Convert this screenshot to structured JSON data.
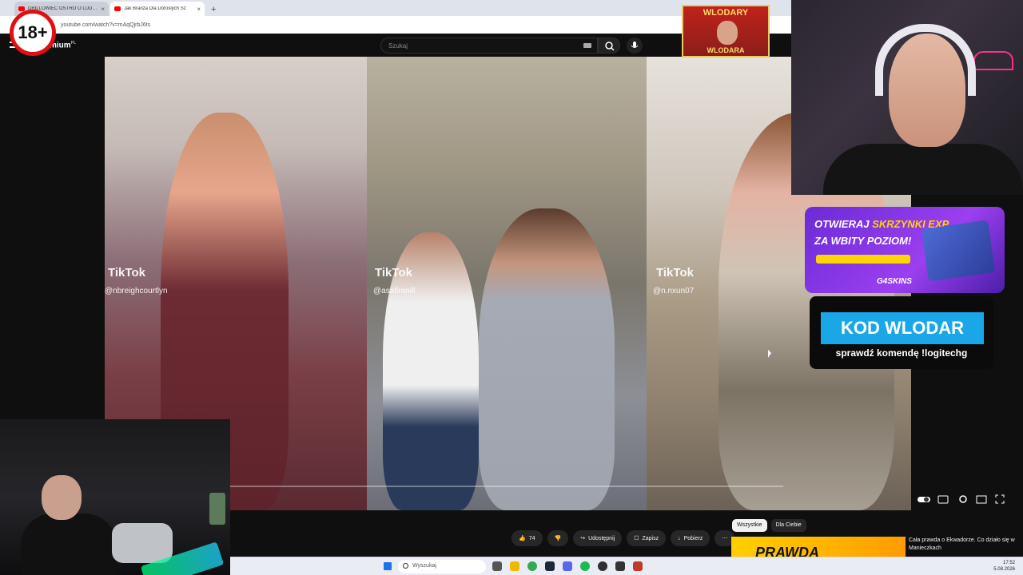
{
  "browser": {
    "tabs": [
      {
        "title": "DRILLOWIEC OSTRO O LUDZIACH",
        "active": false
      },
      {
        "title": "Jak Branza Dla Doroslych Sz",
        "active": true
      }
    ],
    "new_tab": "+",
    "close": "×",
    "url": "youtube.com/watch?v=mAqQjrbJ6ts"
  },
  "youtube": {
    "logo_text": "mium",
    "logo_region": "PL",
    "search_placeholder": "Szukaj",
    "actions": {
      "likes": "74",
      "share": "Udostępnij",
      "save": "Zapisz",
      "download": "Pobierz",
      "more": "⋯"
    },
    "chips": [
      "Wszystkie",
      "Dla Ciebie"
    ],
    "recommended": {
      "thumb_text": "PRAWDA",
      "title": "Cała prawda o Ekwadorze. Co działo się w Manieczkach"
    }
  },
  "video": {
    "tiktok_label": "TikTok",
    "users": [
      "@nbreighcourtlyn",
      "@asafiranill",
      "@n.nxun07"
    ]
  },
  "overlays": {
    "age_badge": "18+",
    "poster_line1": "WLODARY",
    "poster_line2": "WLODARA",
    "ad1_line1_prefix": "OTWIERAJ",
    "ad1_line1_highlight": "SKRZYNKI EXP",
    "ad1_line2": "ZA WBITY POZIOM!",
    "ad1_brand": "G4SKINS",
    "ad2_code": "KOD WLODAR",
    "ad2_sub": "sprawdź komendę !logitechg"
  },
  "taskbar": {
    "search_placeholder": "Wyszukaj",
    "time": "17:52",
    "date": "5.08.2026"
  },
  "colors": {
    "accent_red": "#ff0000",
    "ad_purple": "#6a2bd6",
    "ad_blue": "#19a7e8",
    "badge_red": "#e01010"
  }
}
